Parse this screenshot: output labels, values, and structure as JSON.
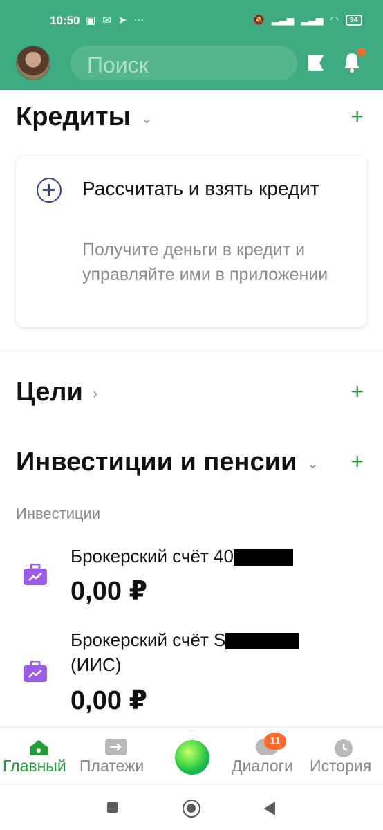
{
  "status_bar": {
    "time": "10:50",
    "battery": "94",
    "more": "···"
  },
  "header": {
    "search_placeholder": "Поиск"
  },
  "credits": {
    "title": "Кредиты",
    "add": "+",
    "card_title": "Рассчитать и взять кредит",
    "card_desc": "Получите деньги в кредит и управляйте ими в приложении"
  },
  "goals": {
    "title": "Цели",
    "add": "+"
  },
  "investments": {
    "title": "Инвестиции и пенсии",
    "add": "+",
    "subhead": "Инвестиции",
    "accounts": [
      {
        "name": "Брокерский счёт 40",
        "amount": "0,00 ₽"
      },
      {
        "name_line1": "Брокерский счёт S",
        "name_line2": "(ИИС)",
        "amount": "0,00 ₽"
      }
    ]
  },
  "bottom_nav": {
    "items": [
      {
        "label": "Главный",
        "icon": "home-icon"
      },
      {
        "label": "Платежи",
        "icon": "payments-icon"
      },
      {
        "label": "",
        "icon": "assistant-orb-icon"
      },
      {
        "label": "Диалоги",
        "icon": "chat-icon",
        "badge": "11"
      },
      {
        "label": "История",
        "icon": "history-icon"
      }
    ]
  },
  "colors": {
    "brand": "#3fab82",
    "accent_green": "#21a038",
    "badge_orange": "#ff6a2b",
    "invest_purple": "#9b5de5"
  }
}
